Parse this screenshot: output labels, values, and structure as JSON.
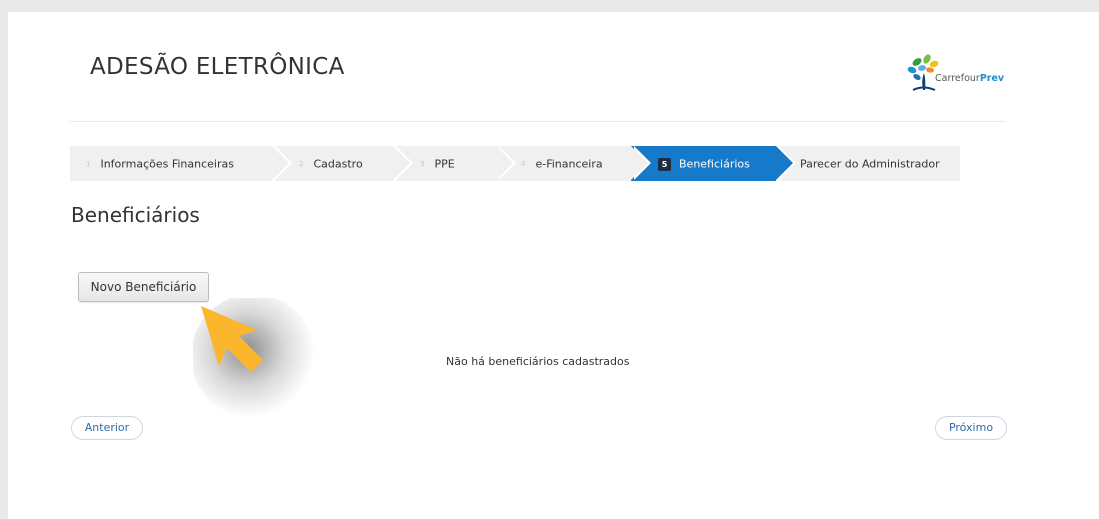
{
  "header": {
    "title": "ADESÃO ELETRÔNICA",
    "logo_text_main": "Carrefour",
    "logo_text_accent": "Prev"
  },
  "steps": [
    {
      "number": "1",
      "label": "Informações Financeiras",
      "active": false
    },
    {
      "number": "2",
      "label": "Cadastro",
      "active": false
    },
    {
      "number": "3",
      "label": "PPE",
      "active": false
    },
    {
      "number": "4",
      "label": "e-Financeira",
      "active": false
    },
    {
      "number": "5",
      "label": "Beneficiários",
      "active": true
    },
    {
      "number": "",
      "label": "Parecer do Administrador",
      "active": false
    }
  ],
  "page": {
    "heading": "Beneficiários",
    "new_button_label": "Novo Beneficiário",
    "empty_message": "Não há beneficiários cadastrados"
  },
  "nav": {
    "previous_label": "Anterior",
    "next_label": "Próximo"
  },
  "colors": {
    "accent": "#1679c9",
    "step_bg": "#f0f0f0",
    "link": "#2f6aa5",
    "cursor": "#fbb62d"
  },
  "icons": [
    "carrefourprev-logo-icon",
    "mouse-cursor-icon"
  ]
}
